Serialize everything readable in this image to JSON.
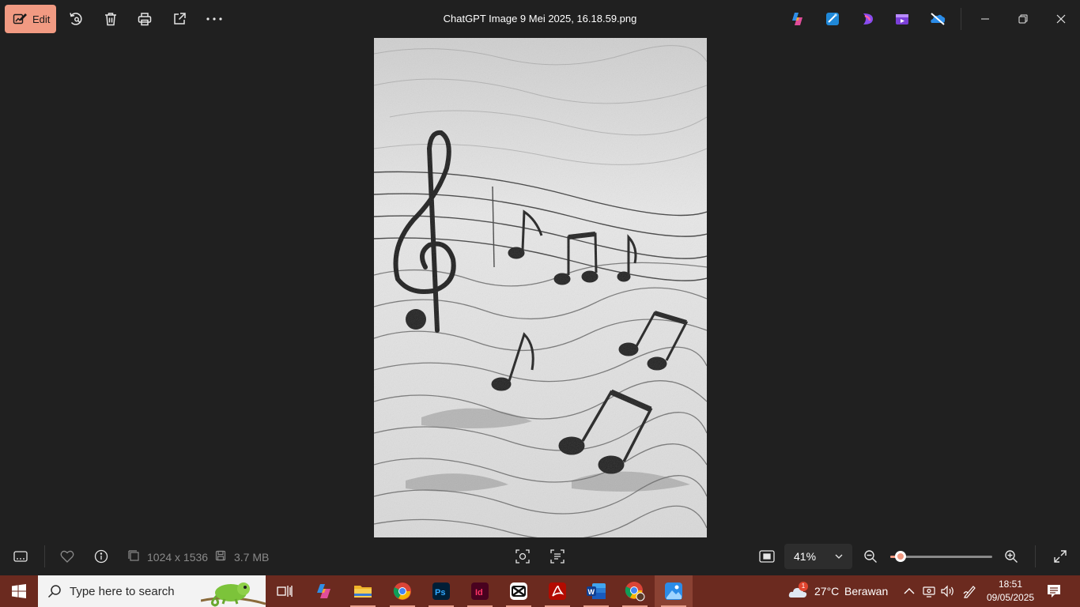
{
  "toolbar": {
    "edit_label": "Edit",
    "title": "ChatGPT Image 9 Mei 2025, 16.18.59.png",
    "icons": [
      "rotate-icon",
      "delete-icon",
      "print-icon",
      "share-icon",
      "more-icon"
    ],
    "app_icons": [
      "copilot-icon",
      "photo-editor-icon",
      "clipchamp-icon",
      "video-editor-icon",
      "onedrive-icon"
    ],
    "window_controls": [
      "minimize",
      "restore",
      "close"
    ]
  },
  "image_info": {
    "dimensions": "1024 x 1536",
    "file_size": "3.7 MB"
  },
  "zoom": {
    "level_label": "41%",
    "slider_value": 0.1
  },
  "taskbar": {
    "search_placeholder": "Type here to search",
    "apps": [
      "task-view",
      "copilot",
      "file-explorer",
      "chrome",
      "photoshop",
      "indesign",
      "capcut",
      "acrobat",
      "word",
      "chrome-profile",
      "photos"
    ],
    "weather_temp": "27°C",
    "weather_desc": "Berawan",
    "weather_badge": "1",
    "time": "18:51",
    "date": "09/05/2025"
  },
  "colors": {
    "accent": "#f19a82",
    "background": "#202020",
    "taskbar": "#6b2a1f"
  }
}
